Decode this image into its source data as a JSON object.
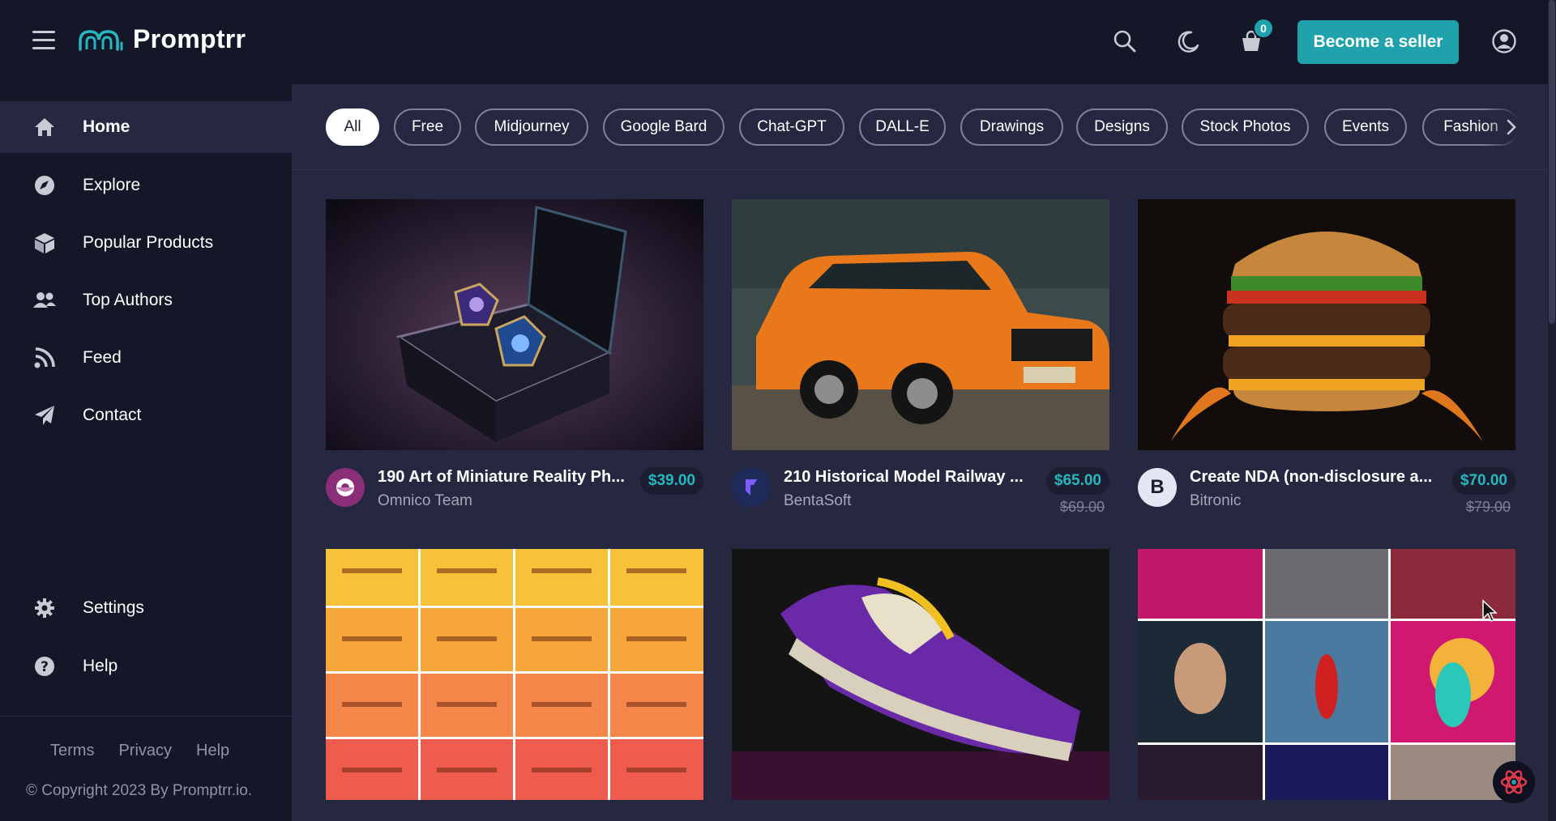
{
  "header": {
    "brand": "Promptrr",
    "cart_count": "0",
    "seller_button": "Become a seller"
  },
  "sidebar": {
    "items": [
      {
        "label": "Home",
        "icon": "home-icon"
      },
      {
        "label": "Explore",
        "icon": "compass-icon"
      },
      {
        "label": "Popular Products",
        "icon": "box-icon"
      },
      {
        "label": "Top Authors",
        "icon": "users-icon"
      },
      {
        "label": "Feed",
        "icon": "rss-icon"
      },
      {
        "label": "Contact",
        "icon": "paper-plane-icon"
      }
    ],
    "bottom_items": [
      {
        "label": "Settings",
        "icon": "gear-icon"
      },
      {
        "label": "Help",
        "icon": "question-circle-icon"
      }
    ],
    "footer_links": [
      "Terms",
      "Privacy",
      "Help"
    ],
    "copyright": "© Copyright 2023 By Promptrr.io."
  },
  "filters": [
    "All",
    "Free",
    "Midjourney",
    "Google Bard",
    "Chat-GPT",
    "DALL-E",
    "Drawings",
    "Designs",
    "Stock Photos",
    "Events",
    "Fashion"
  ],
  "products": [
    {
      "title": "190 Art of Miniature Reality Ph...",
      "author": "Omnico Team",
      "price": "$39.00",
      "old_price": "",
      "avatar": ""
    },
    {
      "title": "210 Historical Model Railway ...",
      "author": "BentaSoft",
      "price": "$65.00",
      "old_price": "$69.00",
      "avatar": ""
    },
    {
      "title": "Create NDA (non-disclosure a...",
      "author": "Bitronic",
      "price": "$70.00",
      "old_price": "$79.00",
      "avatar": "B"
    }
  ],
  "colors": {
    "header_bg": "#141728",
    "main_bg": "#252840",
    "accent": "#1fa2ab",
    "price": "#27b6bf"
  }
}
